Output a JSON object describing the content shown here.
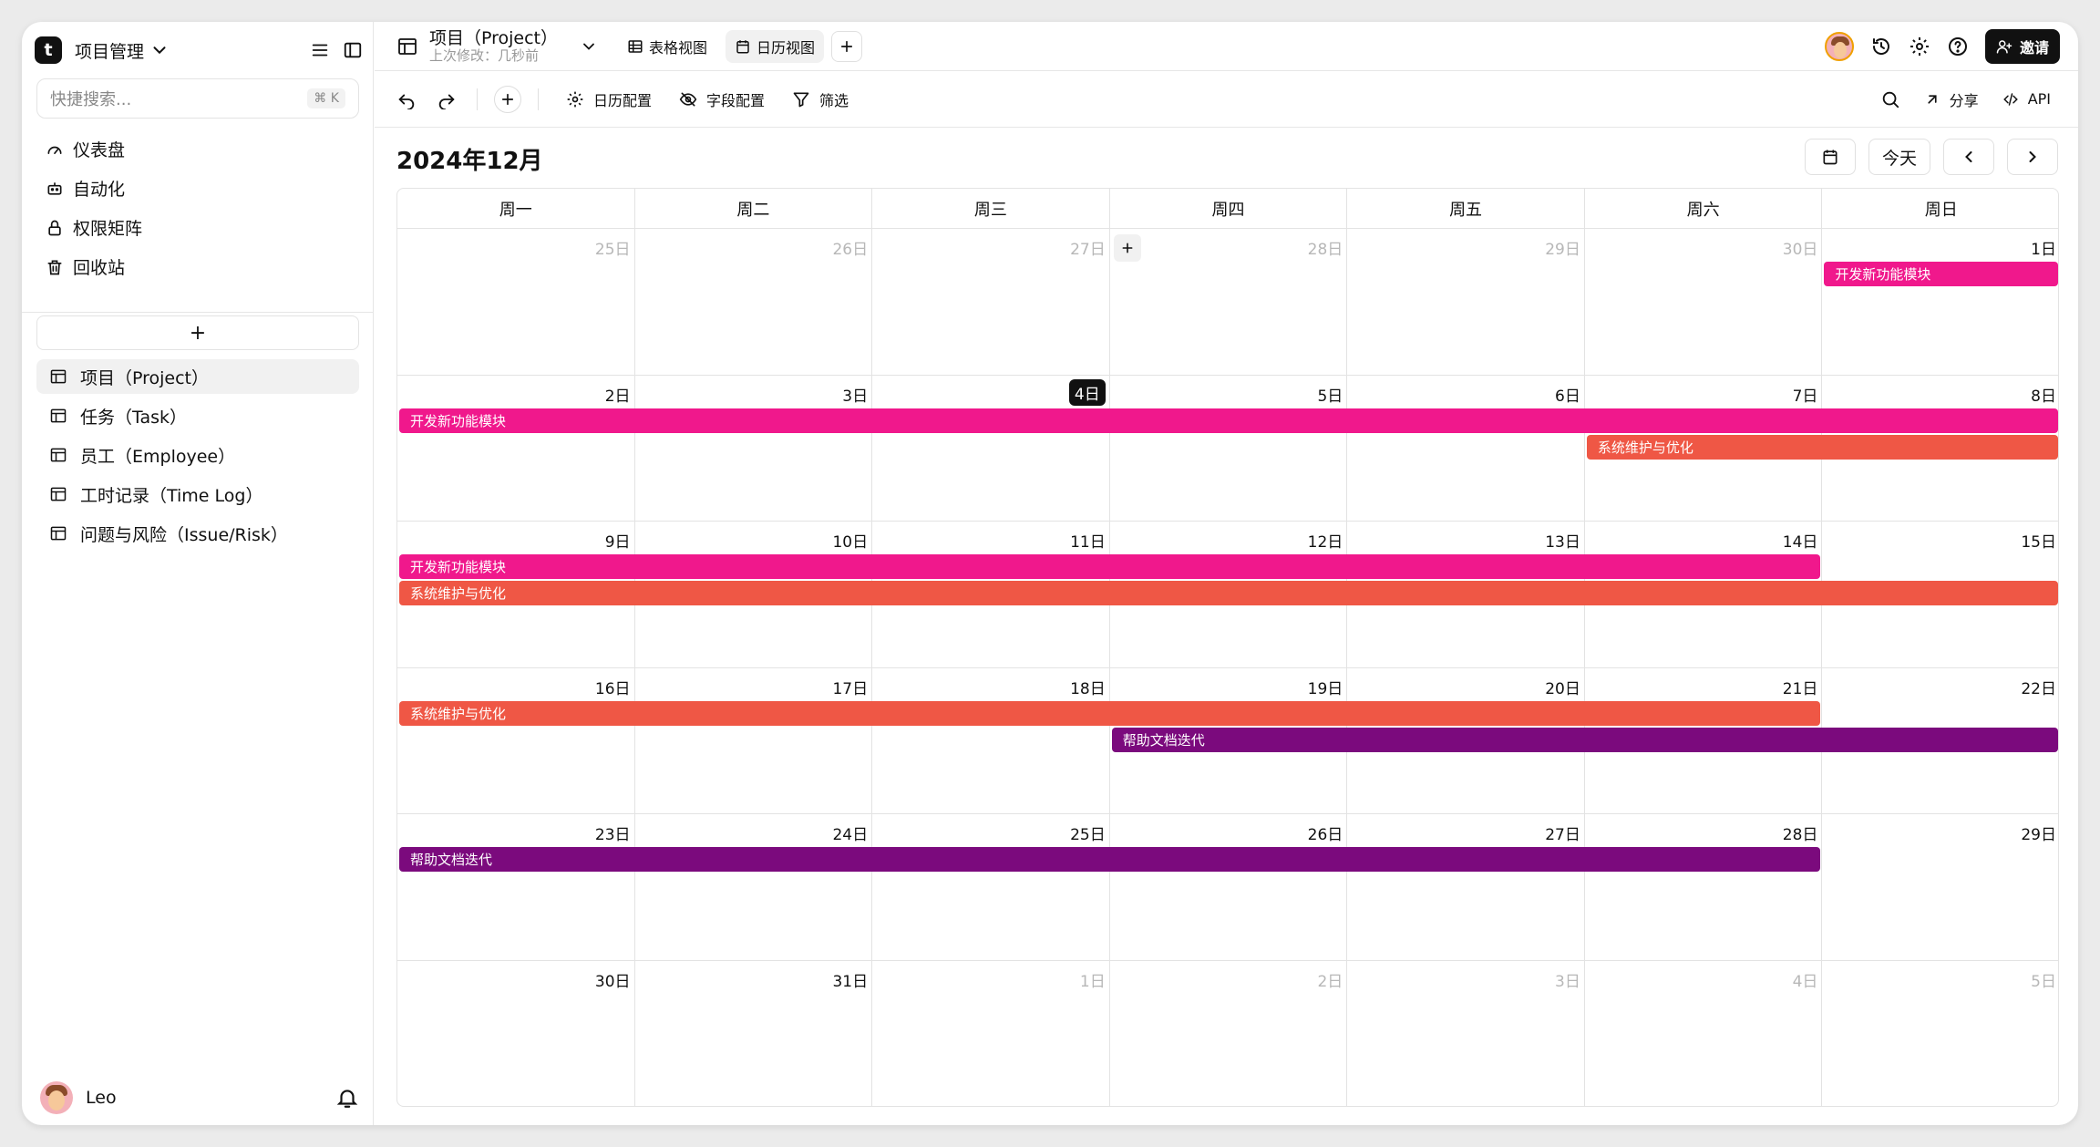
{
  "sidebar": {
    "logo_letter": "t",
    "workspace": "项目管理",
    "search_placeholder": "快捷搜索...",
    "search_shortcut": "⌘ K",
    "nav": [
      "仪表盘",
      "自动化",
      "权限矩阵",
      "回收站"
    ],
    "add_label": "+",
    "tables": [
      "项目（Project）",
      "任务（Task）",
      "员工（Employee）",
      "工时记录（Time Log）",
      "问题与风险（Issue/Risk）"
    ],
    "user": "Leo"
  },
  "topbar": {
    "table_name": "项目（Project）",
    "last_modified": "上次修改：几秒前",
    "views": [
      "表格视图",
      "日历视图"
    ],
    "invite": "邀请"
  },
  "toolbar": {
    "calendar_config": "日历配置",
    "field_config": "字段配置",
    "filter": "筛选",
    "share": "分享",
    "api": "API"
  },
  "calendar": {
    "month_title": "2024年12月",
    "today_button": "今天",
    "weekdays": [
      "周一",
      "周二",
      "周三",
      "周四",
      "周五",
      "周六",
      "周日"
    ],
    "weeks": [
      [
        {
          "d": "25日",
          "muted": true
        },
        {
          "d": "26日",
          "muted": true
        },
        {
          "d": "27日",
          "muted": true
        },
        {
          "d": "28日",
          "muted": true
        },
        {
          "d": "29日",
          "muted": true
        },
        {
          "d": "30日",
          "muted": true
        },
        {
          "d": "1日"
        }
      ],
      [
        {
          "d": "2日"
        },
        {
          "d": "3日"
        },
        {
          "d": "4日",
          "today": true
        },
        {
          "d": "5日"
        },
        {
          "d": "6日"
        },
        {
          "d": "7日"
        },
        {
          "d": "8日"
        }
      ],
      [
        {
          "d": "9日"
        },
        {
          "d": "10日"
        },
        {
          "d": "11日"
        },
        {
          "d": "12日"
        },
        {
          "d": "13日"
        },
        {
          "d": "14日"
        },
        {
          "d": "15日"
        }
      ],
      [
        {
          "d": "16日"
        },
        {
          "d": "17日"
        },
        {
          "d": "18日"
        },
        {
          "d": "19日"
        },
        {
          "d": "20日"
        },
        {
          "d": "21日"
        },
        {
          "d": "22日"
        }
      ],
      [
        {
          "d": "23日"
        },
        {
          "d": "24日"
        },
        {
          "d": "25日"
        },
        {
          "d": "26日"
        },
        {
          "d": "27日"
        },
        {
          "d": "28日"
        },
        {
          "d": "29日"
        }
      ],
      [
        {
          "d": "30日"
        },
        {
          "d": "31日"
        },
        {
          "d": "1日",
          "muted": true
        },
        {
          "d": "2日",
          "muted": true
        },
        {
          "d": "3日",
          "muted": true
        },
        {
          "d": "4日",
          "muted": true
        },
        {
          "d": "5日",
          "muted": true
        }
      ]
    ],
    "events": [
      {
        "week": 0,
        "start": 6,
        "end": 6,
        "lane": 0,
        "title": "开发新功能模块",
        "color": "#f0188c"
      },
      {
        "week": 1,
        "start": 0,
        "end": 6,
        "lane": 0,
        "title": "开发新功能模块",
        "color": "#f0188c"
      },
      {
        "week": 1,
        "start": 5,
        "end": 6,
        "lane": 1,
        "title": "系统维护与优化",
        "color": "#ef5745"
      },
      {
        "week": 2,
        "start": 0,
        "end": 5,
        "lane": 0,
        "title": "开发新功能模块",
        "color": "#f0188c"
      },
      {
        "week": 2,
        "start": 0,
        "end": 6,
        "lane": 1,
        "title": "系统维护与优化",
        "color": "#ef5745"
      },
      {
        "week": 3,
        "start": 0,
        "end": 5,
        "lane": 0,
        "title": "系统维护与优化",
        "color": "#ef5745"
      },
      {
        "week": 3,
        "start": 3,
        "end": 6,
        "lane": 1,
        "title": "帮助文档迭代",
        "color": "#7b0a7d"
      },
      {
        "week": 4,
        "start": 0,
        "end": 5,
        "lane": 0,
        "title": "帮助文档迭代",
        "color": "#7b0a7d"
      }
    ]
  }
}
